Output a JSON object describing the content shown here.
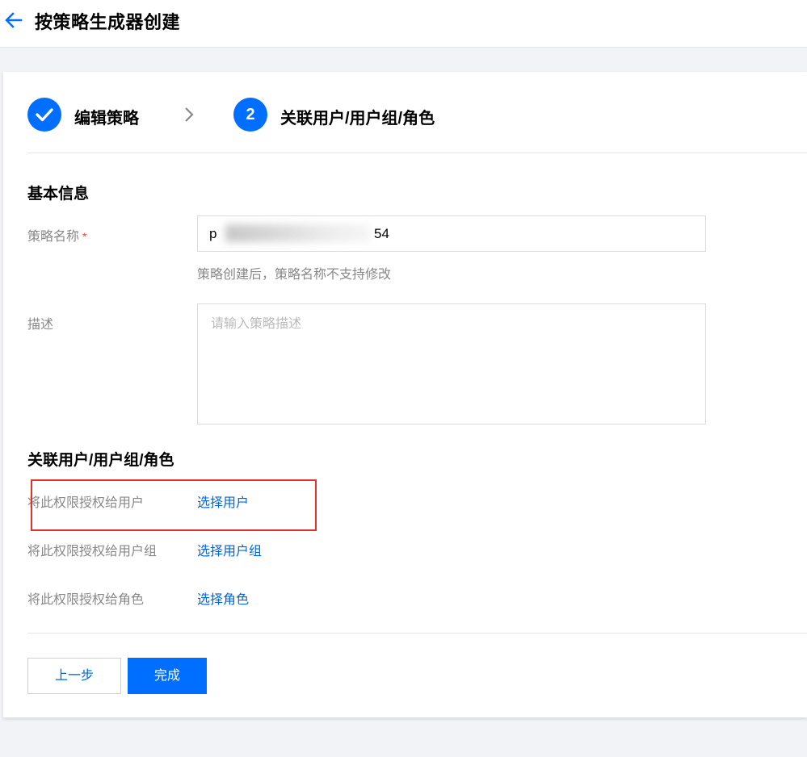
{
  "header": {
    "title": "按策略生成器创建",
    "back_icon": "arrow-left-icon"
  },
  "steps": [
    {
      "label": "编辑策略",
      "state": "done",
      "icon": "check-icon"
    },
    {
      "number": "2",
      "label": "关联用户/用户组/角色",
      "state": "active"
    }
  ],
  "basic_info": {
    "title": "基本信息",
    "name_label": "策略名称",
    "required_mark": "*",
    "name_value_prefix": "p",
    "name_value_suffix": "54",
    "name_help": "策略创建后，策略名称不支持修改",
    "desc_label": "描述",
    "desc_placeholder": "请输入策略描述"
  },
  "association": {
    "title": "关联用户/用户组/角色",
    "rows": [
      {
        "label": "将此权限授权给用户",
        "link": "选择用户"
      },
      {
        "label": "将此权限授权给用户组",
        "link": "选择用户组"
      },
      {
        "label": "将此权限授权给角色",
        "link": "选择角色"
      }
    ]
  },
  "footer": {
    "prev_label": "上一步",
    "done_label": "完成"
  },
  "colors": {
    "primary": "#006eff",
    "link": "#0066e0",
    "highlight": "#e0322d"
  }
}
